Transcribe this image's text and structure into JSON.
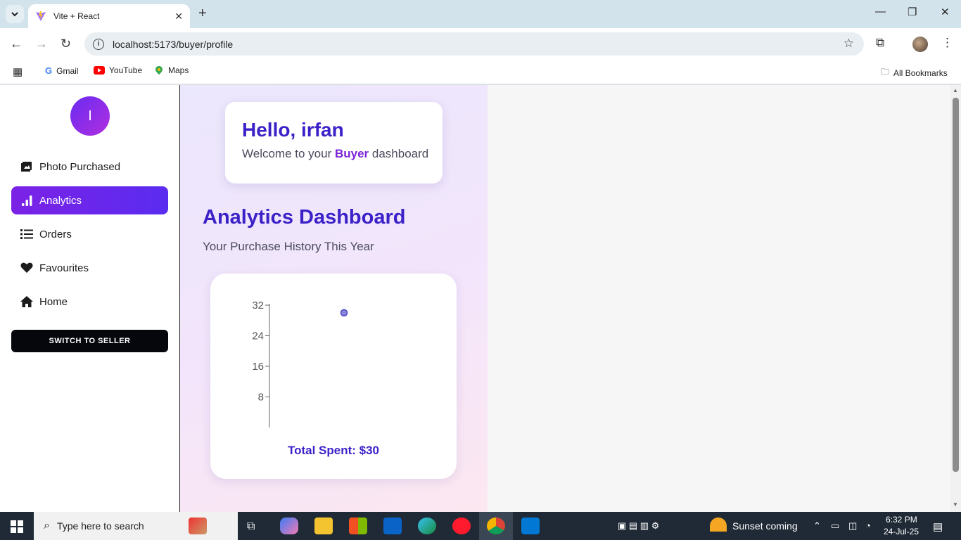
{
  "browser": {
    "tab_title": "Vite + React",
    "url": "localhost:5173/buyer/profile",
    "bookmarks": [
      {
        "label": "Gmail",
        "icon": "google-icon"
      },
      {
        "label": "YouTube",
        "icon": "youtube-icon"
      },
      {
        "label": "Maps",
        "icon": "maps-icon"
      }
    ],
    "all_bookmarks": "All Bookmarks"
  },
  "sidebar": {
    "avatar_initial": "I",
    "items": [
      {
        "label": "Photo Purchased",
        "icon": "image-icon"
      },
      {
        "label": "Analytics",
        "icon": "bar-chart-icon",
        "active": true
      },
      {
        "label": "Orders",
        "icon": "list-icon"
      },
      {
        "label": "Favourites",
        "icon": "heart-icon"
      },
      {
        "label": "Home",
        "icon": "home-icon"
      }
    ],
    "switch_label": "SWITCH TO SELLER"
  },
  "greeting": {
    "title": "Hello, irfan",
    "sub_prefix": "Welcome to your ",
    "role": "Buyer",
    "sub_suffix": " dashboard"
  },
  "dashboard": {
    "title": "Analytics Dashboard",
    "subtitle": "Your Purchase History This Year",
    "total_spent": "Total Spent: $30"
  },
  "chart_data": {
    "type": "scatter",
    "title": "",
    "xlabel": "",
    "ylabel": "",
    "y_ticks": [
      8,
      16,
      24,
      32
    ],
    "ylim": [
      0,
      32
    ],
    "points": [
      {
        "y": 30
      }
    ],
    "point_color": "#8884d8",
    "grid": false
  },
  "taskbar": {
    "search_placeholder": "Type here to search",
    "weather": "Sunset coming",
    "time": "6:32 PM",
    "date": "24-Jul-25"
  },
  "colors": {
    "accent": "#3b21c8",
    "active_nav": "#6a2cf0",
    "role": "#7a22d8"
  }
}
